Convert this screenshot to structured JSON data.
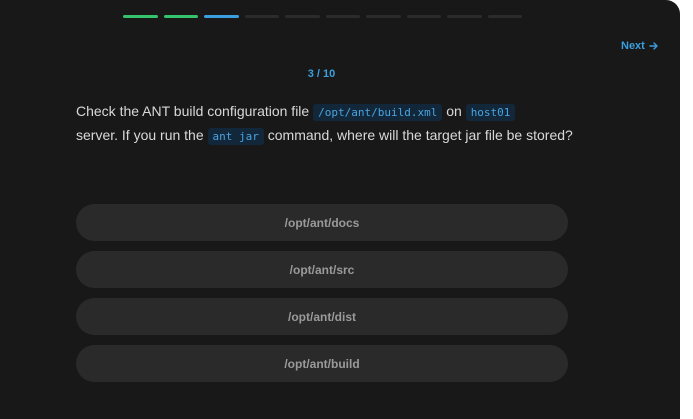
{
  "colors": {
    "panel_bg": "#181818",
    "accent_blue": "#3b9ede",
    "done_green": "#34c26c",
    "pending_gray": "#2b2b2b",
    "option_bg": "#2a2a2a"
  },
  "progress": {
    "total": 10,
    "completed": 2,
    "current": 3,
    "steps": [
      "done",
      "done",
      "current",
      "pending",
      "pending",
      "pending",
      "pending",
      "pending",
      "pending",
      "pending"
    ]
  },
  "nav": {
    "next_label": "Next",
    "next_icon": "arrow-right-icon"
  },
  "question": {
    "counter": "3 / 10",
    "text_1": "Check the ANT build configuration file ",
    "code_1": "/opt/ant/build.xml",
    "text_2": " on ",
    "code_2": "host01",
    "text_3": " server. If you run the ",
    "code_3": "ant jar",
    "text_4": " command, where will the target jar file be stored?"
  },
  "options": [
    "/opt/ant/docs",
    "/opt/ant/src",
    "/opt/ant/dist",
    "/opt/ant/build"
  ]
}
